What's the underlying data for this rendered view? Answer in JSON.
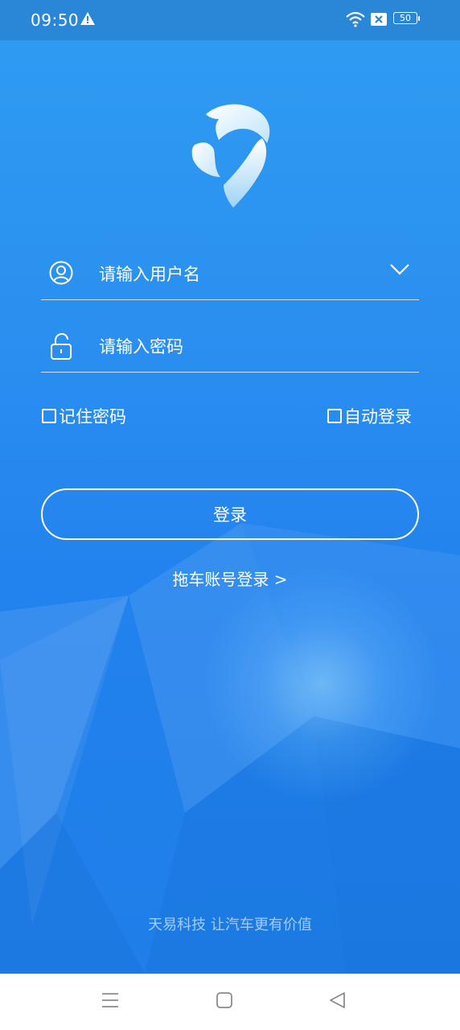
{
  "status_bar": {
    "time": "09:50",
    "battery": "50",
    "icons": [
      "warning-icon",
      "wifi-icon",
      "sim-error-icon",
      "battery-icon"
    ]
  },
  "login_form": {
    "username_placeholder": "请输入用户名",
    "password_placeholder": "请输入密码",
    "remember_password_label": "记住密码",
    "auto_login_label": "自动登录",
    "login_button_label": "登录",
    "tow_account_link": "拖车账号登录 >"
  },
  "footer": {
    "slogan": "天易科技 让汽车更有价值"
  },
  "colors": {
    "background_top": "#2f9cf2",
    "background_bottom": "#1f7ee8",
    "status_bar": "#2a87d8",
    "text": "#ffffff",
    "slogan": "#d2e6fa"
  }
}
